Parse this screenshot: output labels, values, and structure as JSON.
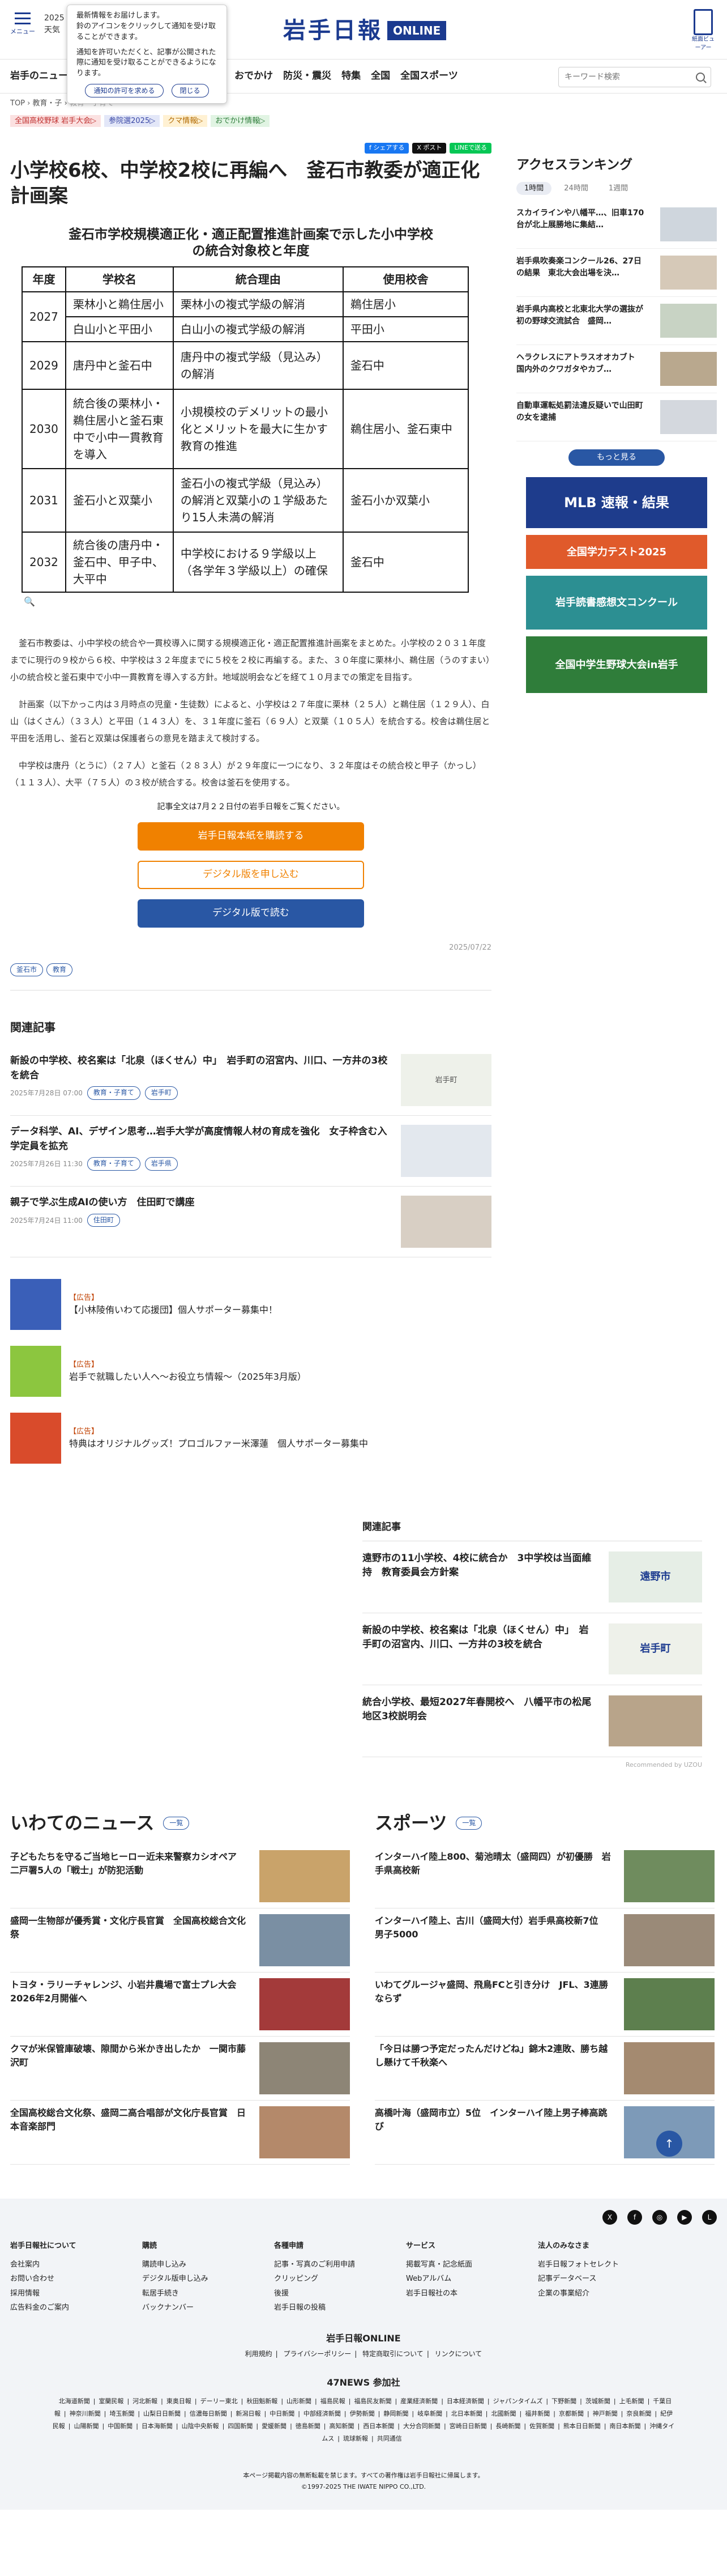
{
  "header": {
    "menu_label": "メニュー",
    "date": "2025",
    "weather_label": "天気",
    "logo_jp": "岩手日報",
    "logo_en": "ONLINE",
    "app_label": "紙面ビューアー"
  },
  "notification": {
    "line1": "最新情報をお届けします。",
    "line2": "鈴のアイコンをクリックして通知を受け取ることができます。",
    "line3": "通知を許可いただくと、記事が公開された際に通知を受け取ることができるようになります。",
    "allow_label": "通知の許可を求める",
    "deny_label": "閉じる"
  },
  "nav": {
    "lead": "岩手のニュース",
    "items": [
      "おでかけ",
      "防災・震災",
      "特集",
      "全国",
      "全国スポーツ"
    ],
    "search_placeholder": "キーワード検索"
  },
  "breadcrumb": {
    "home": "TOP",
    "sep": "›",
    "cat": "教育・子",
    "last": "教育・子育て"
  },
  "topic_tags": [
    {
      "label": "全国高校野球 岩手大会▷",
      "bg": "#fbe1e1",
      "fg": "#c0302f"
    },
    {
      "label": "参院選2025▷",
      "bg": "#e3e7f8",
      "fg": "#3745a5"
    },
    {
      "label": "クマ情報▷",
      "bg": "#fff1d3",
      "fg": "#b26a00"
    },
    {
      "label": "おでかけ情報▷",
      "bg": "#e1f4e3",
      "fg": "#2e7d3a"
    }
  ],
  "share": {
    "facebook": "f シェアする",
    "x": "X ポスト",
    "line": "LINEで送る"
  },
  "article": {
    "title": "小学校6校、中学校2校に再編へ　釜石市教委が適正化計画案",
    "figure_caption_1": "釜石市学校規模適正化・適正配置推進計画案で示した小中学校",
    "figure_caption_2": "の統合対象校と年度",
    "table": {
      "headers": [
        "年度",
        "学校名",
        "統合理由",
        "使用校舎"
      ],
      "rows": [
        [
          "2027",
          "栗林小と鵜住居小",
          "栗林小の複式学級の解消",
          "鵜住居小"
        ],
        [
          "",
          "白山小と平田小",
          "白山小の複式学級の解消",
          "平田小"
        ],
        [
          "2029",
          "唐丹中と釜石中",
          "唐丹中の複式学級（見込み）の解消",
          "釜石中"
        ],
        [
          "2030",
          "統合後の栗林小・鵜住居小と釜石東中で小中一貫教育を導入",
          "小規模校のデメリットの最小化とメリットを最大に生かす教育の推進",
          "鵜住居小、釜石東中"
        ],
        [
          "2031",
          "釜石小と双葉小",
          "釜石小の複式学級（見込み）の解消と双葉小の１学級あたり15人未満の解消",
          "釜石小か双葉小"
        ],
        [
          "2032",
          "統合後の唐丹中・釜石中、甲子中、大平中",
          "中学校における９学級以上（各学年３学級以上）の確保",
          "釜石中"
        ]
      ]
    },
    "zoom_icon": "magnifier-icon",
    "paragraphs": [
      "釜石市教委は、小中学校の統合や一貫校導入に関する規模適正化・適正配置推進計画案をまとめた。小学校の２０３１年度までに現行の９校から６校、中学校は３２年度までに５校を２校に再編する。また、３０年度に栗林小、鵜住居（うのすまい）小の統合校と釜石東中で小中一貫教育を導入する方針。地域説明会などを経て１０月までの策定を目指す。",
      "計画案（以下かっこ内は３月時点の児童・生徒数）によると、小学校は２７年度に栗林（２５人）と鵜住居（１２９人）、白山（はくさん）（３３人）と平田（１４３人）を、３１年度に釜石（６９人）と双葉（１０５人）を統合する。校舎は鵜住居と平田を活用し、釜石と双葉は保護者らの意見を踏まえて検討する。",
      "中学校は唐丹（とうに）（２７人）と釜石（２８３人）が２９年度に一つになり、３２年度はその統合校と甲子（かっし）（１１３人）、大平（７５人）の３校が統合する。校舎は釜石を使用する。"
    ],
    "note": "記事全文は7月２２日付の岩手日報をご覧ください。",
    "cta_purchase": "岩手日報本紙を購読する",
    "cta_apply": "デジタル版を申し込む",
    "cta_read": "デジタル版で読む",
    "published": "2025/07/22",
    "tags": [
      "釜石市",
      "教育"
    ]
  },
  "related": {
    "heading": "関連記事",
    "items": [
      {
        "title": "新設の中学校、校名案は「北泉（ほくせん）中」　岩手町の沼宮内、川口、一方井の3校を統合",
        "date": "2025年7月28日 07:00",
        "tags": [
          "教育・子育て",
          "岩手町"
        ],
        "thumb": "岩手町"
      },
      {
        "title": "データ科学、AI、デザイン思考…岩手大学が高度情報人材の育成を強化　女子枠含む入学定員を拡充",
        "date": "2025年7月26日 11:30",
        "tags": [
          "教育・子育て",
          "岩手県"
        ],
        "thumb": ""
      },
      {
        "title": "親子で学ぶ生成AIの使い方　住田町で講座",
        "date": "2025年7月24日 11:00",
        "tags": [
          "住田町"
        ],
        "thumb": ""
      }
    ]
  },
  "ads": [
    {
      "label": "【広告】",
      "text": "【小林陵侑いわて応援団】個人サポーター募集中！",
      "color": "#3a5fb8"
    },
    {
      "label": "【広告】",
      "text": "岩手で就職したい人へ〜お役立ち情報〜（2025年3月版）",
      "color": "#8cc63f"
    },
    {
      "label": "【広告】",
      "text": "特典はオリジナルグッズ！プロゴルファー米澤蓮　個人サポーター募集中",
      "color": "#d94b2b"
    }
  ],
  "widget": {
    "heading": "関連記事",
    "items": [
      {
        "title": "遠野市の11小学校、4校に統合か　3中学校は当面維持　教育委員会方針案",
        "thumb": "遠野市"
      },
      {
        "title": "新設の中学校、校名案は「北泉（ほくせん）中」　岩手町の沼宮内、川口、一方井の3校を統合",
        "thumb": "岩手町"
      },
      {
        "title": "統合小学校、最短2027年春開校へ　八幡平市の松尾地区3校説明会",
        "thumb": ""
      }
    ],
    "by": "Recommended by UZOU"
  },
  "sidebar": {
    "ranking_title": "アクセスランキング",
    "tabs": [
      "1時間",
      "24時間",
      "1週間"
    ],
    "items": [
      "スカイラインや八幡平…、旧車170台が北上展勝地に集結…",
      "岩手県吹奏楽コンクール26、27日の結果　東北大会出場を決…",
      "岩手県内高校と北東北大学の選抜が初の野球交流試合　盛岡…",
      "ヘラクレスにアトラスオオカブト　国内外のクワガタやカブ…",
      "自動車運転処罰法違反疑いで山田町の女を逮捕"
    ],
    "more": "もっと見る",
    "banners": [
      {
        "text": "MLB 速報・結果",
        "bg": "#1e3c8c"
      },
      {
        "text": "全国学力テスト2025",
        "bg": "#e05a2b"
      },
      {
        "text": "岩手読書感想文コンクール",
        "bg": "#2c8f92"
      },
      {
        "text": "全国中学生野球大会in岩手",
        "bg": "#2f7d3a"
      }
    ]
  },
  "news_sections": [
    {
      "heading": "いわてのニュース",
      "list_label": "一覧",
      "items": [
        "子どもたちを守るご当地ヒーロー近未来警察カシオペア　二戸署5人の「戦士」が防犯活動",
        "盛岡一生物部が優秀賞・文化庁長官賞　全国高校総合文化祭",
        "トヨタ・ラリーチャレンジ、小岩井農場で富士プレ大会　2026年2月開催へ",
        "クマが米保管庫破壊、隙間から米かき出したか　一関市藤沢町",
        "全国高校総合文化祭、盛岡二高合唱部が文化庁長官賞　日本音楽部門"
      ]
    },
    {
      "heading": "スポーツ",
      "list_label": "一覧",
      "items": [
        "インターハイ陸上800、菊池晴太（盛岡四）が初優勝　岩手県高校新",
        "インターハイ陸上、古川（盛岡大付）岩手県高校新7位　男子5000",
        "いわてグルージャ盛岡、飛鳥FCと引き分け　JFL、3連勝ならず",
        "「今日は勝つ予定だったんだけどね」錦木2連敗、勝ち越し懸けて千秋楽へ",
        "高橋叶海（盛岡市立）5位　インターハイ陸上男子棒高跳び"
      ]
    }
  ],
  "footer": {
    "cols": [
      {
        "h": "岩手日報社について",
        "items": [
          "会社案内",
          "お問い合わせ",
          "採用情報",
          "広告料金のご案内"
        ]
      },
      {
        "h": "購読",
        "items": [
          "購読申し込み",
          "デジタル版申し込み",
          "転居手続き",
          "バックナンバー"
        ]
      },
      {
        "h": "各種申請",
        "items": [
          "記事・写真のご利用申請",
          "クリッピング",
          "後援",
          "岩手日報の投稿"
        ]
      },
      {
        "h": "サービス",
        "items": [
          "掲載写真・記念紙面",
          "Webアルバム",
          "岩手日報社の本"
        ]
      },
      {
        "h": "法人のみなさま",
        "items": [
          "岩手日報フォトセレクト",
          "記事データベース",
          "企業の事業紹介"
        ]
      }
    ],
    "online": "岩手日報ONLINE",
    "links": [
      "利用規約",
      "プライバシーポリシー",
      "特定商取引について",
      "リンクについて"
    ],
    "network": "47NEWS 参加社",
    "papers": [
      "北海道新聞",
      "室蘭民報",
      "河北新報",
      "東奥日報",
      "デーリー東北",
      "秋田魁新報",
      "山形新聞",
      "福島民報",
      "福島民友新聞",
      "産業経済新聞",
      "日本経済新聞",
      "ジャパンタイムズ",
      "下野新聞",
      "茨城新聞",
      "上毛新聞",
      "千葉日報",
      "神奈川新聞",
      "埼玉新聞",
      "山梨日日新聞",
      "信濃毎日新聞",
      "新潟日報",
      "中日新聞",
      "中部経済新聞",
      "伊勢新聞",
      "静岡新聞",
      "岐阜新聞",
      "北日本新聞",
      "北國新聞",
      "福井新聞",
      "京都新聞",
      "神戸新聞",
      "奈良新聞",
      "紀伊民報",
      "山陽新聞",
      "中国新聞",
      "日本海新聞",
      "山陰中央新報",
      "四国新聞",
      "愛媛新聞",
      "徳島新聞",
      "高知新聞",
      "西日本新聞",
      "大分合同新聞",
      "宮崎日日新聞",
      "長崎新聞",
      "佐賀新聞",
      "熊本日日新聞",
      "南日本新聞",
      "沖縄タイムス",
      "琉球新報",
      "共同通信"
    ],
    "copy1": "本ページ掲載内容の無断転載を禁じます。すべての著作権は岩手日報社に帰属します。",
    "copy2": "©1997-2025 THE IWATE NIPPO CO.,LTD."
  },
  "to_top": "↑"
}
